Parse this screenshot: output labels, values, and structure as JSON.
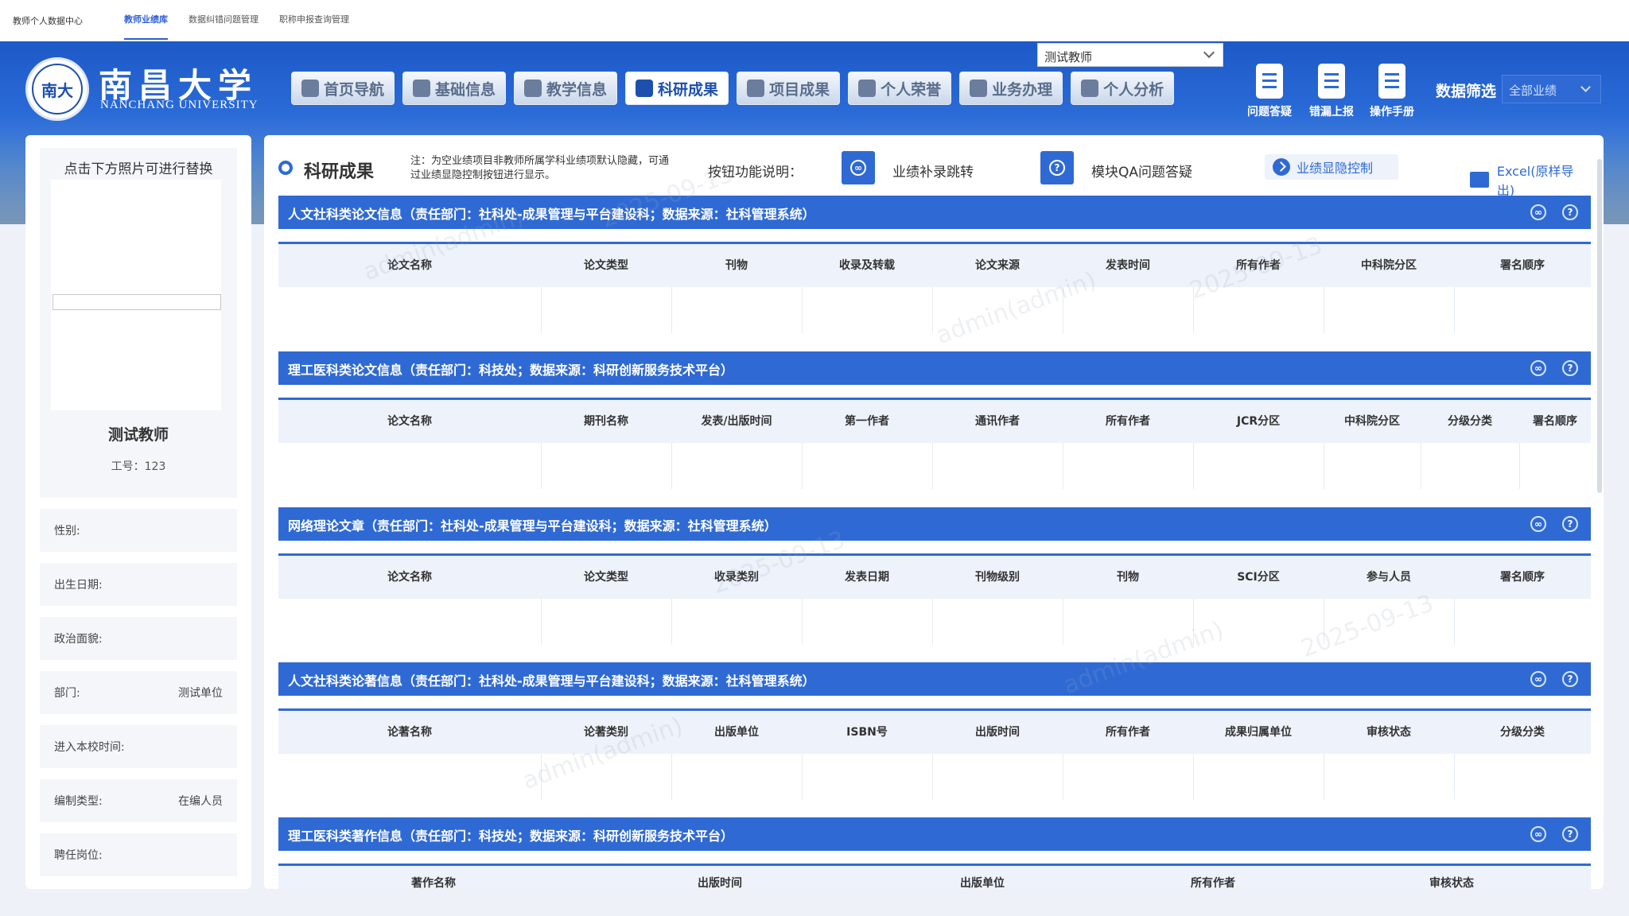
{
  "topbar": {
    "brand": "教师个人数据中心",
    "tabs": [
      "教师业绩库",
      "数据纠错问题管理",
      "职称申报查询管理"
    ]
  },
  "header": {
    "university_cn": "南昌大学",
    "university_en": "NANCHANG UNIVERSITY",
    "logo_text": "南大",
    "nav": [
      {
        "label": "首页导航",
        "icon": "home-icon"
      },
      {
        "label": "基础信息",
        "icon": "grid-icon"
      },
      {
        "label": "教学信息",
        "icon": "teach-icon"
      },
      {
        "label": "科研成果",
        "icon": "flask-icon"
      },
      {
        "label": "项目成果",
        "icon": "document-icon"
      },
      {
        "label": "个人荣誉",
        "icon": "medal-icon"
      },
      {
        "label": "业务办理",
        "icon": "workflow-icon"
      },
      {
        "label": "个人分析",
        "icon": "analysis-icon"
      }
    ],
    "active_nav": "科研成果",
    "teacher_select": "测试教师",
    "tools": [
      {
        "label": "问题答疑",
        "icon": "qa-icon"
      },
      {
        "label": "错漏上报",
        "icon": "upload-icon"
      },
      {
        "label": "操作手册",
        "icon": "manual-icon"
      }
    ],
    "filter_label": "数据筛选",
    "filter_value": "全部业绩"
  },
  "profile": {
    "photo_hint": "点击下方照片可进行替换",
    "name": "测试教师",
    "employee_no": "工号：123",
    "fields": [
      {
        "label": "性别:",
        "value": ""
      },
      {
        "label": "出生日期:",
        "value": ""
      },
      {
        "label": "政治面貌:",
        "value": ""
      },
      {
        "label": "部门:",
        "value": "测试单位"
      },
      {
        "label": "进入本校时间:",
        "value": ""
      },
      {
        "label": "编制类型:",
        "value": "在编人员"
      },
      {
        "label": "聘任岗位:",
        "value": ""
      }
    ]
  },
  "main": {
    "title": "科研成果",
    "note": "注：为空业绩项目非教师所属学科业绩项默认隐藏，可通过业绩显隐控制按钮进行显示。",
    "btn_desc_label": "按钮功能说明：",
    "btn1_label": "业绩补录跳转",
    "btn2_label": "模块QA问题答疑",
    "toggle_label": "业绩显隐控制",
    "export_label": "Excel(原样导出)",
    "sections": [
      {
        "title": "人文社科类论文信息（责任部门：社科处-成果管理与平台建设科；数据来源：社科管理系统）",
        "columns": [
          "论文名称",
          "论文类型",
          "刊物",
          "收录及转载",
          "论文来源",
          "发表时间",
          "所有作者",
          "中科院分区",
          "署名顺序"
        ]
      },
      {
        "title": "理工医科类论文信息（责任部门：科技处；数据来源：科研创新服务技术平台）",
        "columns": [
          "论文名称",
          "期刊名称",
          "发表/出版时间",
          "第一作者",
          "通讯作者",
          "所有作者",
          "JCR分区",
          "中科院分区",
          "分级分类",
          "署名顺序"
        ]
      },
      {
        "title": "网络理论文章（责任部门：社科处-成果管理与平台建设科；数据来源：社科管理系统）",
        "columns": [
          "论文名称",
          "论文类型",
          "收录类别",
          "发表日期",
          "刊物级别",
          "刊物",
          "SCI分区",
          "参与人员",
          "署名顺序"
        ]
      },
      {
        "title": "人文社科类论著信息（责任部门：社科处-成果管理与平台建设科；数据来源：社科管理系统）",
        "columns": [
          "论著名称",
          "论著类别",
          "出版单位",
          "ISBN号",
          "出版时间",
          "所有作者",
          "成果归属单位",
          "审核状态",
          "分级分类"
        ]
      },
      {
        "title": "理工医科类著作信息（责任部门：科技处；数据来源：科研创新服务技术平台）",
        "columns": [
          "著作名称",
          "出版时间",
          "出版单位",
          "所有作者",
          "审核状态"
        ]
      }
    ]
  },
  "watermark": {
    "user": "admin(admin)",
    "date": "2025-09-13"
  },
  "colors": {
    "primary": "#2f6ad4",
    "header_bg": "#edf2fb",
    "panel": "#f4f6fa"
  }
}
